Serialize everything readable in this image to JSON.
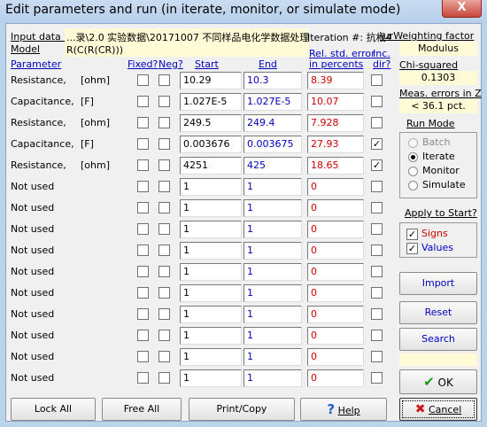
{
  "window": {
    "title": "Edit parameters and run (in iterate, monitor, or simulate mode)",
    "close": "X"
  },
  "header": {
    "input_data_label": "Input data :",
    "input_data_value": "...录\\2.0 实验数据\\20171007 不同样品电化学数据处理",
    "iteration_label": "Iteration #: 抗栰4",
    "model_label": "Model",
    "model_value": "R(C(R(CR)))",
    "weighting_label": "\\urWeighting factor",
    "weighting_value": "Modulus"
  },
  "columns": {
    "parameter": "Parameter",
    "fixed": "Fixed?",
    "neg": "Neg?",
    "start": "Start",
    "end": "End",
    "rel_err_1": "Rel. std. error",
    "rel_err_2": "in percents",
    "inc_1": "Inc.",
    "inc_2": "dir?"
  },
  "rows": [
    {
      "name": "Resistance,",
      "unit": "[ohm]",
      "start": "10.29",
      "end": "10.3",
      "err": "8.39",
      "fixed": false,
      "neg": false,
      "inc": false
    },
    {
      "name": "Capacitance,",
      "unit": "[F]",
      "start": "1.027E-5",
      "end": "1.027E-5",
      "err": "10.07",
      "fixed": false,
      "neg": false,
      "inc": false
    },
    {
      "name": "Resistance,",
      "unit": "[ohm]",
      "start": "249.5",
      "end": "249.4",
      "err": "7.928",
      "fixed": false,
      "neg": false,
      "inc": false
    },
    {
      "name": "Capacitance,",
      "unit": "[F]",
      "start": "0.003676",
      "end": "0.003675",
      "err": "27.93",
      "fixed": false,
      "neg": false,
      "inc": true
    },
    {
      "name": "Resistance,",
      "unit": "[ohm]",
      "start": "4251",
      "end": "425",
      "err": "18.65",
      "fixed": false,
      "neg": false,
      "inc": true
    },
    {
      "name": "Not used",
      "unit": "",
      "start": "1",
      "end": "1",
      "err": "0",
      "fixed": false,
      "neg": false,
      "inc": false
    },
    {
      "name": "Not used",
      "unit": "",
      "start": "1",
      "end": "1",
      "err": "0",
      "fixed": false,
      "neg": false,
      "inc": false
    },
    {
      "name": "Not used",
      "unit": "",
      "start": "1",
      "end": "1",
      "err": "0",
      "fixed": false,
      "neg": false,
      "inc": false
    },
    {
      "name": "Not used",
      "unit": "",
      "start": "1",
      "end": "1",
      "err": "0",
      "fixed": false,
      "neg": false,
      "inc": false
    },
    {
      "name": "Not used",
      "unit": "",
      "start": "1",
      "end": "1",
      "err": "0",
      "fixed": false,
      "neg": false,
      "inc": false
    },
    {
      "name": "Not used",
      "unit": "",
      "start": "1",
      "end": "1",
      "err": "0",
      "fixed": false,
      "neg": false,
      "inc": false
    },
    {
      "name": "Not used",
      "unit": "",
      "start": "1",
      "end": "1",
      "err": "0",
      "fixed": false,
      "neg": false,
      "inc": false
    },
    {
      "name": "Not used",
      "unit": "",
      "start": "1",
      "end": "1",
      "err": "0",
      "fixed": false,
      "neg": false,
      "inc": false
    },
    {
      "name": "Not used",
      "unit": "",
      "start": "1",
      "end": "1",
      "err": "0",
      "fixed": false,
      "neg": false,
      "inc": false
    },
    {
      "name": "Not used",
      "unit": "",
      "start": "1",
      "end": "1",
      "err": "0",
      "fixed": false,
      "neg": false,
      "inc": false
    }
  ],
  "side": {
    "chi_label": "Chi-squared",
    "chi_value": "0.1303",
    "meas_label": "Meas. errors in Z",
    "meas_value": "< 36.1 pct.",
    "run_mode_label": "Run Mode",
    "modes": [
      "Batch",
      "Iterate",
      "Monitor",
      "Simulate"
    ],
    "selected_mode": "Iterate",
    "apply_label": "Apply to Start?",
    "signs_label": "Signs",
    "values_label": "Values",
    "import_label": "Import",
    "reset_label": "Reset",
    "search_label": "Search",
    "ok_label": "OK",
    "checkmark": "✔",
    "crossmark": "✖",
    "questionmark": "?",
    "checkbox_mark": "✓"
  },
  "buttons": {
    "lock_all": "Lock All",
    "free_all": "Free All",
    "print_copy": "Print/Copy",
    "help": "Help",
    "cancel": "Cancel"
  }
}
